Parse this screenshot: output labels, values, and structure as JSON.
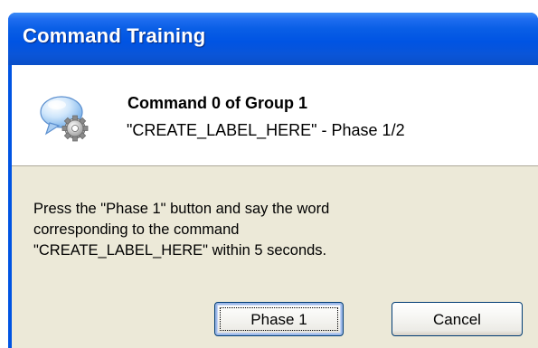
{
  "window": {
    "title": "Command Training"
  },
  "header": {
    "title": "Command 0 of Group 1",
    "subtitle": "\"CREATE_LABEL_HERE\" - Phase 1/2",
    "icon": "speech-bubble-gear-icon"
  },
  "message": {
    "lines": [
      "Press the \"Phase 1\" button and say the word",
      "corresponding to the command",
      "\"CREATE_LABEL_HERE\" within 5 seconds."
    ]
  },
  "buttons": {
    "phase": "Phase 1",
    "cancel": "Cancel"
  },
  "colors": {
    "titlebar": "#0054e3",
    "dialog_background": "#ece9d8",
    "header_background": "#ffffff",
    "button_border": "#003c74"
  }
}
